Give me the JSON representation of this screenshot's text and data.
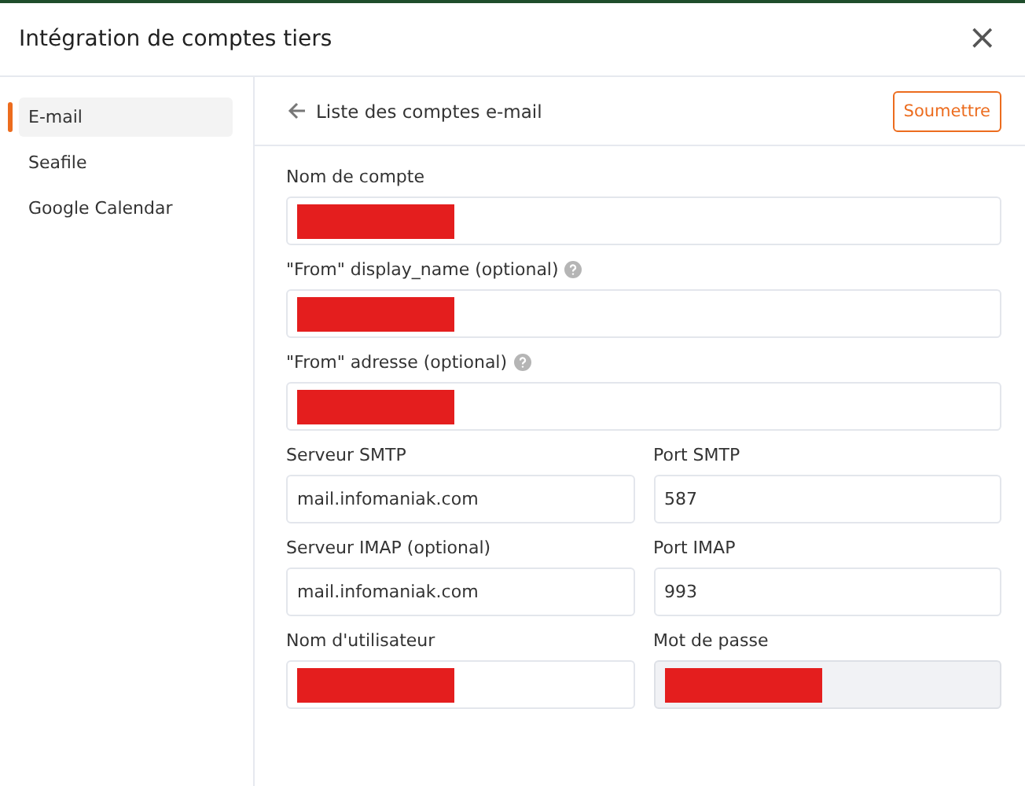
{
  "dialog": {
    "title": "Intégration de comptes tiers",
    "close": "×"
  },
  "sidebar": {
    "items": [
      {
        "label": "E-mail",
        "selected": true
      },
      {
        "label": "Seafile",
        "selected": false
      },
      {
        "label": "Google Calendar",
        "selected": false
      }
    ]
  },
  "panel": {
    "back_link": "Liste des comptes e-mail",
    "submit": "Soumettre"
  },
  "form_rows": [
    [
      {
        "label": "Nom de compte",
        "redacted": true
      }
    ],
    [
      {
        "label": "\"From\" display_name (optional)",
        "help": true,
        "redacted": true
      }
    ],
    [
      {
        "label": "\"From\" adresse (optional)",
        "help": true,
        "redacted": true
      }
    ],
    [
      {
        "label": "Serveur SMTP",
        "value": "mail.infomaniak.com"
      },
      {
        "label": "Port SMTP",
        "value": "587"
      }
    ],
    [
      {
        "label": "Serveur IMAP (optional)",
        "value": "mail.infomaniak.com"
      },
      {
        "label": "Port IMAP",
        "value": "993"
      }
    ],
    [
      {
        "label": "Nom d'utilisateur",
        "redacted": true
      },
      {
        "label": "Mot de passe",
        "redacted": true,
        "disabled": true
      }
    ]
  ]
}
